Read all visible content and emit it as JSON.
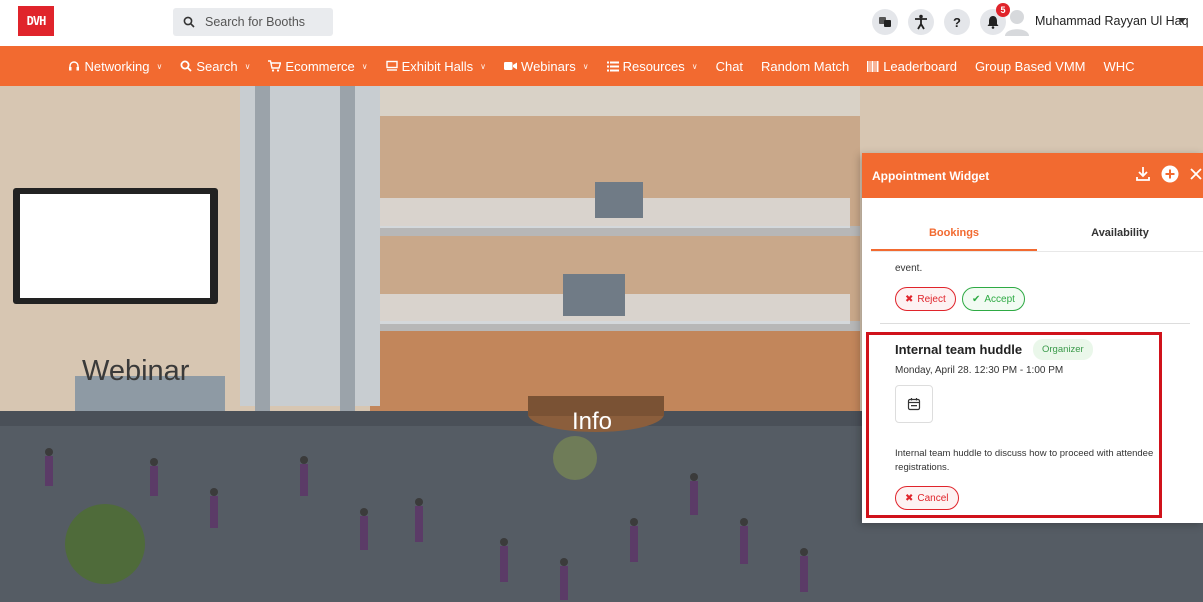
{
  "header": {
    "logo_text": "DVH",
    "search": {
      "placeholder": "Search for Booths"
    },
    "notifications_count": "5",
    "user_name": "Muhammad Rayyan Ul Haq",
    "help_label": "?"
  },
  "nav": {
    "items": [
      {
        "label": "Networking",
        "icon": "headset-icon",
        "has_dropdown": true
      },
      {
        "label": "Search",
        "icon": "search-icon",
        "has_dropdown": true
      },
      {
        "label": "Ecommerce",
        "icon": "cart-icon",
        "has_dropdown": true
      },
      {
        "label": "Exhibit Halls",
        "icon": "hall-icon",
        "has_dropdown": true
      },
      {
        "label": "Webinars",
        "icon": "video-icon",
        "has_dropdown": true
      },
      {
        "label": "Resources",
        "icon": "list-icon",
        "has_dropdown": true
      },
      {
        "label": "Chat",
        "has_dropdown": false
      },
      {
        "label": "Random Match",
        "has_dropdown": false
      },
      {
        "label": "Leaderboard",
        "icon": "barcode-icon",
        "has_dropdown": false
      },
      {
        "label": "Group Based VMM",
        "has_dropdown": false
      },
      {
        "label": "WHC",
        "has_dropdown": false
      }
    ]
  },
  "scene": {
    "webinar_sign": "Webinar",
    "info_sign": "Info"
  },
  "widget": {
    "title": "Appointment Widget",
    "tabs": [
      {
        "label": "Bookings",
        "active": true
      },
      {
        "label": "Availability",
        "active": false
      }
    ],
    "previous_item_text": "event.",
    "reject_label": "Reject",
    "accept_label": "Accept",
    "appointment": {
      "title": "Internal team huddle",
      "role": "Organizer",
      "time": "Monday, April 28. 12:30 PM - 1:00 PM",
      "description": "Internal team huddle to discuss how to proceed with attendee registrations.",
      "cancel_label": "Cancel"
    }
  },
  "colors": {
    "brand_orange": "#f26a30",
    "brand_red": "#e0242b",
    "accept_green": "#2eaa44",
    "highlight_red": "#d0121b"
  }
}
